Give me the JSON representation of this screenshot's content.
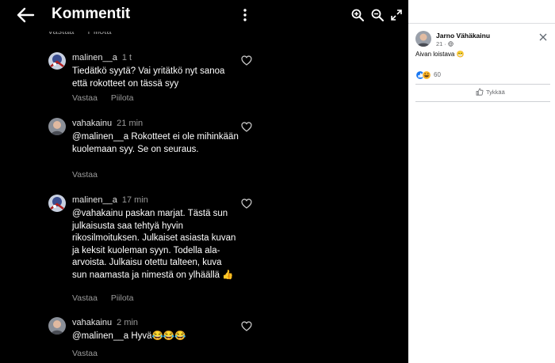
{
  "viewer": {
    "title": "Kommentit",
    "peek_actions": [
      "Vastaa",
      "Piilota"
    ],
    "comments": [
      {
        "author": "malinen__a",
        "time": "1 t",
        "text": "Tiedätkö syytä? Vai yritätkö nyt sanoa että rokotteet on tässä syy",
        "actions": [
          "Vastaa",
          "Piilota"
        ]
      },
      {
        "author": "vahakainu",
        "time": "21 min",
        "text": "@malinen__a  Rokotteet ei ole mihinkään kuolemaan syy. Se on seuraus.",
        "actions": [
          "Vastaa"
        ]
      },
      {
        "author": "malinen__a",
        "time": "17 min",
        "text": "@vahakainu paskan marjat. Tästä sun julkaisusta saa tehtyä hyvin rikosilmoituksen. Julkaiset asiasta kuvan ja keksit kuoleman syyn. Todella ala-arvoista. Julkaisu otettu talteen, kuva sun naamasta ja nimestä on ylhäällä 👍",
        "actions": [
          "Vastaa",
          "Piilota"
        ]
      },
      {
        "author": "vahakainu",
        "time": "2 min",
        "text": "@malinen__a Hyvä😂😂😂",
        "actions": [
          "Vastaa"
        ]
      }
    ]
  },
  "post": {
    "author": "Jarno Vähäkainu",
    "meta": "21 ·",
    "text": "Aivan loistava 😁",
    "reaction_count": "60",
    "like_label": "Tykkää"
  }
}
